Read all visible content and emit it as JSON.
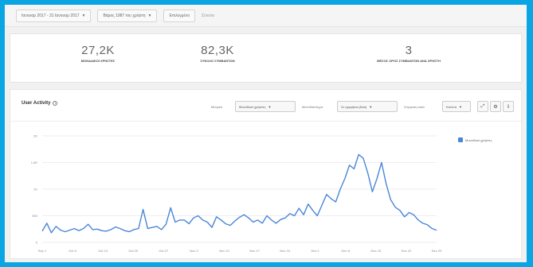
{
  "toolbar": {
    "date_range": "Ιανουαρ 2017 - 31 Ιανουαρ 2017",
    "segment": "Βάρος 1987 του χρήστη",
    "filter": "Επιλεγμένο",
    "clear": "Σύνολο"
  },
  "stats": [
    {
      "value": "27,2K",
      "label": "ΜΟΝΑΔΙΚΟΙ ΧΡΗΣΤΕΣ"
    },
    {
      "value": "82,3K",
      "label": "ΣΥΝΟΛΟ ΣΥΜΒΑΝΤΩΝ"
    },
    {
      "value": "3",
      "label": "ΜΕΣΟΣ ΟΡΟΣ ΣΥΜΒΑΝΤΩΝ ΑΝΑ ΧΡΗΣΤΗ"
    }
  ],
  "panel": {
    "title": "User Activity",
    "metric_label": "Μετρικό",
    "metric_value": "Μοναδικοί χρήστες",
    "interval_label": "Μεσοδιάστημα",
    "interval_value": "Σε ημερήσια βάση",
    "compare_label": "Σύγκριση κατά",
    "compare_value": "Κανένα",
    "legend": "Μοναδικοί χρήστες"
  },
  "colors": {
    "line": "#4a86d8",
    "accent": "#0aa5e3"
  },
  "icons": [
    "caret-down-icon",
    "info-icon",
    "expand-icon",
    "settings-icon",
    "download-icon",
    "checkbox-icon"
  ],
  "chart_data": {
    "type": "line",
    "ylim": [
      0,
      2000
    ],
    "y_ticks": [
      "0",
      "500",
      "1K",
      "1,5K",
      "2K"
    ],
    "x_ticks": [
      "Sep 1",
      "Oct 6",
      "Oct 13",
      "Oct 20",
      "Oct 27",
      "Nov 3",
      "Nov 10",
      "Nov 17",
      "Nov 24",
      "Dec 1",
      "Dec 8",
      "Dec 15",
      "Dec 22",
      "Dec 29"
    ],
    "series": [
      {
        "name": "Μοναδικοί χρήστες",
        "values": [
          210,
          360,
          180,
          300,
          230,
          200,
          230,
          260,
          220,
          260,
          340,
          240,
          250,
          220,
          210,
          240,
          290,
          260,
          220,
          200,
          240,
          260,
          620,
          260,
          280,
          300,
          240,
          340,
          650,
          380,
          420,
          420,
          350,
          460,
          500,
          420,
          380,
          280,
          480,
          420,
          350,
          320,
          400,
          470,
          520,
          460,
          380,
          420,
          360,
          500,
          420,
          360,
          430,
          460,
          540,
          500,
          640,
          520,
          720,
          600,
          500,
          700,
          900,
          820,
          760,
          1000,
          1200,
          1450,
          1380,
          1650,
          1580,
          1300,
          950,
          1200,
          1500,
          1100,
          800,
          660,
          600,
          480,
          560,
          520,
          420,
          360,
          330,
          260,
          230
        ]
      }
    ]
  }
}
